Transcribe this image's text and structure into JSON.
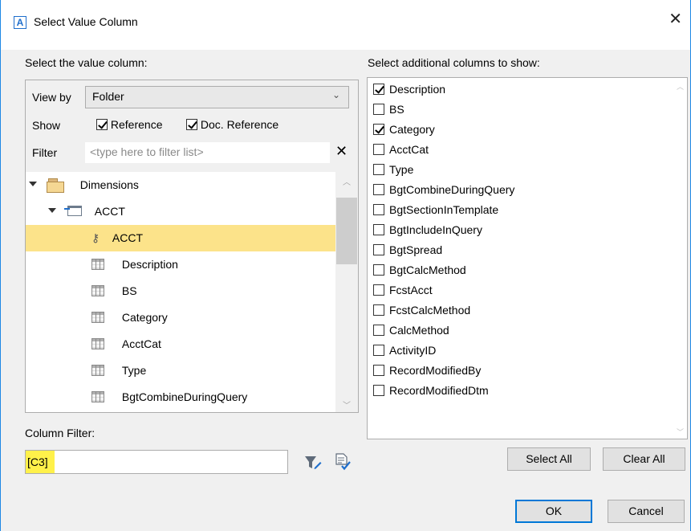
{
  "window": {
    "icon_letter": "A",
    "title": "Select Value Column",
    "close_glyph": "✕"
  },
  "left": {
    "heading": "Select the value column:",
    "view_by_label": "View by",
    "view_by_value": "Folder",
    "show_label": "Show",
    "show_options": [
      {
        "label": "Reference",
        "checked": true
      },
      {
        "label": "Doc. Reference",
        "checked": true
      }
    ],
    "filter_label": "Filter",
    "filter_placeholder": "<type here to filter list>",
    "tree": [
      {
        "label": "Dimensions",
        "icon": "folder-icon",
        "level": 0,
        "expanded": true
      },
      {
        "label": "ACCT",
        "icon": "dimension-icon",
        "level": 1,
        "expanded": true
      },
      {
        "label": "ACCT",
        "icon": "key-icon",
        "level": 2,
        "selected": true
      },
      {
        "label": "Description",
        "icon": "column-icon",
        "level": 2
      },
      {
        "label": "BS",
        "icon": "column-icon",
        "level": 2
      },
      {
        "label": "Category",
        "icon": "column-icon",
        "level": 2
      },
      {
        "label": "AcctCat",
        "icon": "column-icon",
        "level": 2
      },
      {
        "label": "Type",
        "icon": "column-icon",
        "level": 2
      },
      {
        "label": "BgtCombineDuringQuery",
        "icon": "column-icon",
        "level": 2
      }
    ],
    "column_filter_label": "Column Filter:",
    "column_filter_value": "[C3]"
  },
  "right": {
    "heading": "Select additional columns to show:",
    "columns": [
      {
        "label": "Description",
        "checked": true
      },
      {
        "label": "BS",
        "checked": false
      },
      {
        "label": "Category",
        "checked": true
      },
      {
        "label": "AcctCat",
        "checked": false
      },
      {
        "label": "Type",
        "checked": false
      },
      {
        "label": "BgtCombineDuringQuery",
        "checked": false
      },
      {
        "label": "BgtSectionInTemplate",
        "checked": false
      },
      {
        "label": "BgtIncludeInQuery",
        "checked": false
      },
      {
        "label": "BgtSpread",
        "checked": false
      },
      {
        "label": "BgtCalcMethod",
        "checked": false
      },
      {
        "label": "FcstAcct",
        "checked": false
      },
      {
        "label": "FcstCalcMethod",
        "checked": false
      },
      {
        "label": "CalcMethod",
        "checked": false
      },
      {
        "label": "ActivityID",
        "checked": false
      },
      {
        "label": "RecordModifiedBy",
        "checked": false
      },
      {
        "label": "RecordModifiedDtm",
        "checked": false
      }
    ],
    "select_all_label": "Select All",
    "clear_all_label": "Clear All"
  },
  "footer": {
    "ok_label": "OK",
    "cancel_label": "Cancel"
  },
  "colors": {
    "selection": "#fce38a",
    "filter_highlight": "#fff14a",
    "accent": "#0078d7"
  }
}
